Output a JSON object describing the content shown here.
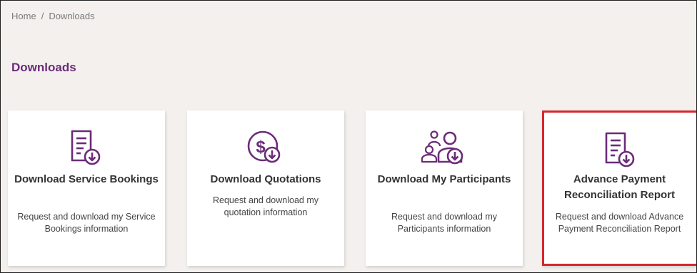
{
  "breadcrumb": {
    "home": "Home",
    "separator": "/",
    "current": "Downloads"
  },
  "page": {
    "title": "Downloads"
  },
  "colors": {
    "accent": "#6b2c78",
    "highlight_border": "#d6262b",
    "background": "#f3f0ed"
  },
  "cards": [
    {
      "icon": "document-download-icon",
      "title": "Download Service Bookings",
      "description": "Request and download my Service Bookings information"
    },
    {
      "icon": "dollar-download-icon",
      "title": "Download Quotations",
      "description": "Request and download my quotation information"
    },
    {
      "icon": "participants-download-icon",
      "title": "Download My Participants",
      "description": "Request and download my Participants information"
    },
    {
      "icon": "document-download-icon",
      "title": "Advance Payment Reconciliation Report",
      "description": "Request and download Advance Payment Reconciliation Report"
    }
  ]
}
